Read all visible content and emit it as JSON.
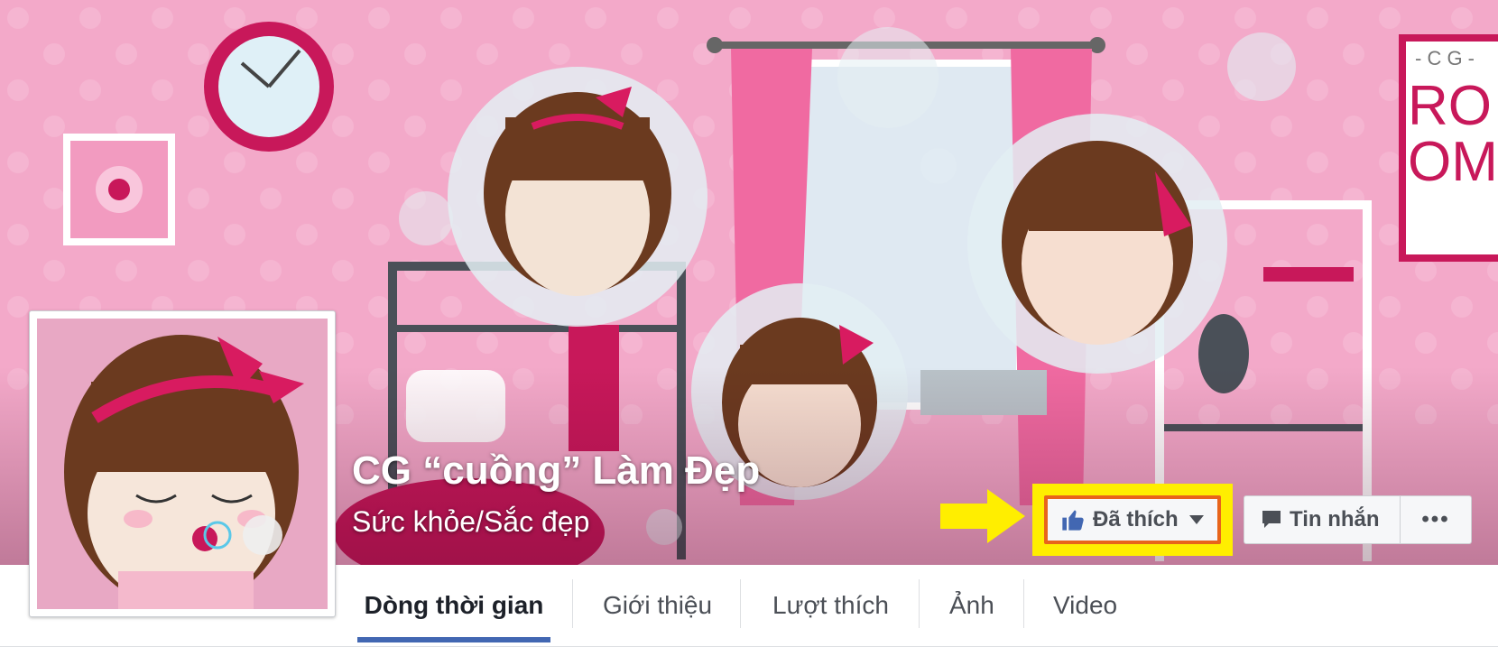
{
  "page": {
    "name": "CG “cuồng” Làm Đẹp",
    "category": "Sức khỏe/Sắc đẹp"
  },
  "actions": {
    "like_label": "Đã thích",
    "message_label": "Tin nhắn",
    "more_label": "•••"
  },
  "cover_sign": {
    "line1": "- C G -",
    "line2": "RO",
    "line3": "OM"
  },
  "tabs": [
    {
      "label": "Dòng thời gian",
      "active": true
    },
    {
      "label": "Giới thiệu",
      "active": false
    },
    {
      "label": "Lượt thích",
      "active": false
    },
    {
      "label": "Ảnh",
      "active": false
    },
    {
      "label": "Video",
      "active": false
    }
  ],
  "colors": {
    "cover_pink": "#f3a9c9",
    "accent_magenta": "#d81b60",
    "highlight_yellow": "#ffee00",
    "highlight_orange": "#e8641b",
    "tab_active_underline": "#4267b2",
    "like_icon_blue": "#4267b2"
  },
  "icons": {
    "like": "thumbs-up-icon",
    "dropdown": "caret-down-icon",
    "message": "speech-bubble-icon",
    "more": "ellipsis-icon",
    "annotation": "yellow-arrow-icon"
  }
}
